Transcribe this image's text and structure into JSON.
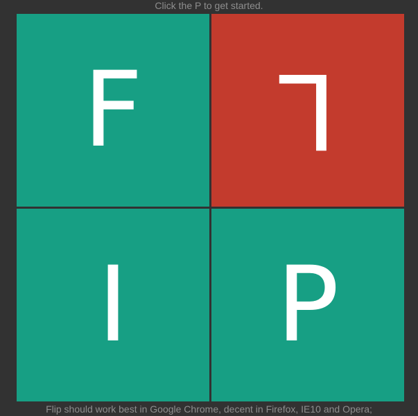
{
  "header": {
    "hint": "Click the P to get started."
  },
  "board": {
    "tiles": [
      {
        "letter": "F",
        "state": "normal"
      },
      {
        "letter": "L",
        "state": "flipped"
      },
      {
        "letter": "I",
        "state": "normal"
      },
      {
        "letter": "P",
        "state": "normal"
      }
    ]
  },
  "footer": {
    "note": "Flip should work best in Google Chrome, decent in Firefox, IE10 and Opera;"
  },
  "colors": {
    "background": "#323232",
    "tile": "#179f84",
    "tile_flipped": "#c33b2d",
    "letter": "#ffffff",
    "text": "#8e8e8e"
  }
}
